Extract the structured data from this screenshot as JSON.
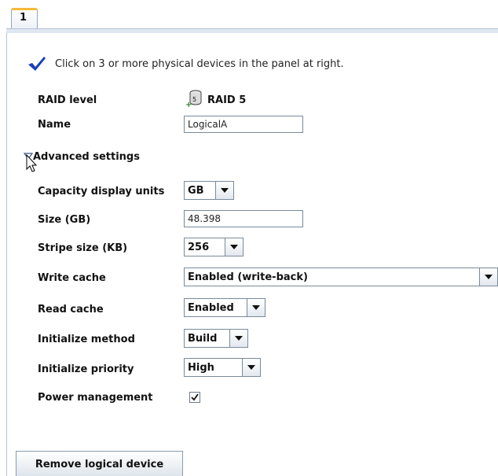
{
  "tab": {
    "label": "1"
  },
  "info": {
    "message": "Click on 3 or more physical devices in the panel at right."
  },
  "fields": {
    "raid_level": {
      "label": "RAID level",
      "value": "RAID 5",
      "icon": "raid5-disk-icon"
    },
    "name": {
      "label": "Name",
      "value": "LogicalA"
    },
    "advanced": {
      "label": "Advanced settings",
      "icon": "collapse-triangle-icon"
    },
    "capacity_units": {
      "label": "Capacity display units",
      "value": "GB"
    },
    "size": {
      "label": "Size (GB)",
      "value": "48.398"
    },
    "stripe_size": {
      "label": "Stripe size (KB)",
      "value": "256"
    },
    "write_cache": {
      "label": "Write cache",
      "value": "Enabled (write-back)"
    },
    "read_cache": {
      "label": "Read cache",
      "value": "Enabled"
    },
    "init_method": {
      "label": "Initialize method",
      "value": "Build"
    },
    "init_priority": {
      "label": "Initialize priority",
      "value": "High"
    },
    "power_mgmt": {
      "label": "Power management",
      "checked": true
    }
  },
  "buttons": {
    "remove": "Remove logical device"
  },
  "colors": {
    "check_accent": "#1a3fb8",
    "tab_highlight": "#f5b93a",
    "panel_border": "#b5c3d6"
  }
}
